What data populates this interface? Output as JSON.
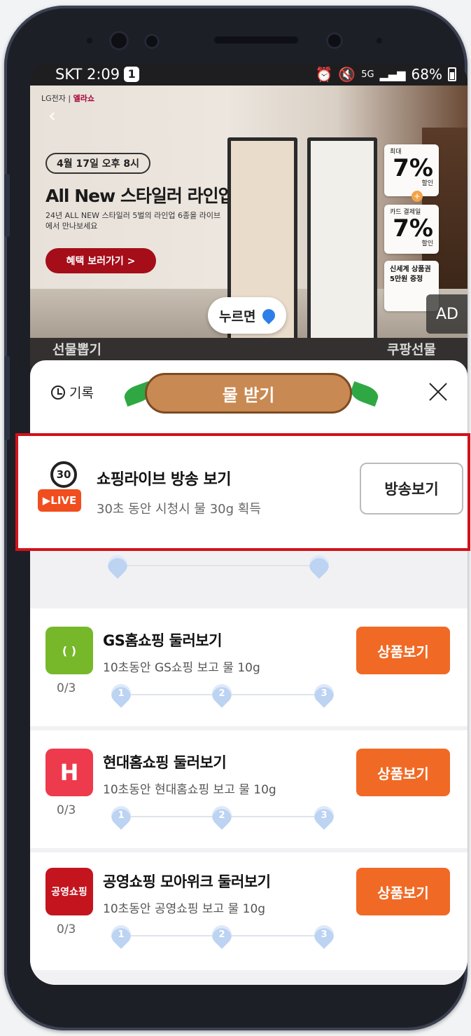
{
  "status_bar": {
    "carrier_time": "SKT 2:09",
    "notification_count": "1",
    "network": "5G",
    "battery": "68%"
  },
  "ad": {
    "brand": "LG전자",
    "brand2": "엘라쇼",
    "date": "4월 17일 오후 8시",
    "title": "All New 스타일러 라인업",
    "subtitle": "24년 ALL NEW 스타일러 5벌의 라인업 6종을 라이브에서 만나보세요",
    "cta": "혜택 보러가기 >",
    "tag1_label": "최대",
    "tag1_value": "7%",
    "tag1_suffix": "할인",
    "tag2_label": "카드 결제일",
    "tag2_value": "7%",
    "tag2_suffix": "할인",
    "tag3_text": "신세계 상품권 5만원 증정",
    "press_label": "누르면",
    "ad_label": "AD"
  },
  "under_ad": {
    "left": "선물뽑기",
    "right": "쿠팡선물"
  },
  "sheet": {
    "history_label": "기록",
    "title": "물 받기"
  },
  "highlight": {
    "timer": "30",
    "badge": "▶LIVE",
    "title": "쇼핑라이브 방송 보기",
    "desc": "30초 동안 시청시 물 30g 획득",
    "button": "방송보기"
  },
  "cards": [
    {
      "icon": "( )",
      "title": "GS홈쇼핑 둘러보기",
      "desc": "10초동안 GS쇼핑 보고 물 10g",
      "count": "0/3",
      "button": "상품보기",
      "color": "#76b82a"
    },
    {
      "icon": "H",
      "title": "현대홈쇼핑 둘러보기",
      "desc": "10초동안 현대홈쇼핑 보고 물 10g",
      "count": "0/3",
      "button": "상품보기",
      "color": "#ee3a4d"
    },
    {
      "icon": "공영쇼핑",
      "title": "공영쇼핑 모아위크 둘러보기",
      "desc": "10초동안 공영쇼핑 보고 물 10g",
      "count": "0/3",
      "button": "상품보기",
      "color": "#c4141e"
    }
  ],
  "colors": {
    "accent": "#f06a25",
    "highlight_border": "#d1121a"
  }
}
